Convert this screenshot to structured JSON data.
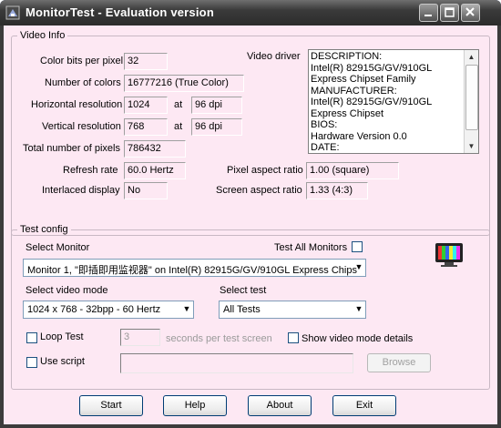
{
  "window": {
    "title": "MonitorTest - Evaluation version"
  },
  "colors": {
    "client_bg": "#fde8f3",
    "titlebar": "#3a3a3a"
  },
  "video_info": {
    "group_label": "Video Info",
    "color_bits_label": "Color bits per pixel",
    "color_bits": "32",
    "num_colors_label": "Number of colors",
    "num_colors": "16777216 (True Color)",
    "h_res_label": "Horizontal resolution",
    "h_res": "1024",
    "h_dpi": "96 dpi",
    "v_res_label": "Vertical resolution",
    "v_res": "768",
    "v_dpi": "96 dpi",
    "at_label": "at",
    "total_pixels_label": "Total number of pixels",
    "total_pixels": "786432",
    "refresh_label": "Refresh rate",
    "refresh": "60.0 Hertz",
    "interlaced_label": "Interlaced display",
    "interlaced": "No",
    "pixel_aspect_label": "Pixel aspect ratio",
    "pixel_aspect": "1.00 (square)",
    "screen_aspect_label": "Screen aspect ratio",
    "screen_aspect": "1.33 (4:3)",
    "driver_label": "Video driver",
    "driver_text": "DESCRIPTION:\nIntel(R) 82915G/GV/910GL Express Chipset Family\nMANUFACTURER:\nIntel(R) 82915G/GV/910GL Express Chipset\nBIOS:\nHardware Version 0.0\nDATE:"
  },
  "test_config": {
    "group_label": "Test config",
    "select_monitor_label": "Select Monitor",
    "test_all_label": "Test All Monitors",
    "monitor_value": "Monitor 1, \"即插即用监视器\" on Intel(R) 82915G/GV/910GL Express Chips",
    "video_mode_label": "Select video mode",
    "video_mode_value": "1024 x 768 - 32bpp - 60 Hertz",
    "select_test_label": "Select test",
    "select_test_value": "All Tests",
    "loop_label": "Loop Test",
    "loop_seconds": "3",
    "seconds_label": "seconds per test screen",
    "show_details_label": "Show video mode details",
    "use_script_label": "Use script",
    "browse_label": "Browse"
  },
  "buttons": {
    "start": "Start",
    "help": "Help",
    "about": "About",
    "exit": "Exit"
  }
}
